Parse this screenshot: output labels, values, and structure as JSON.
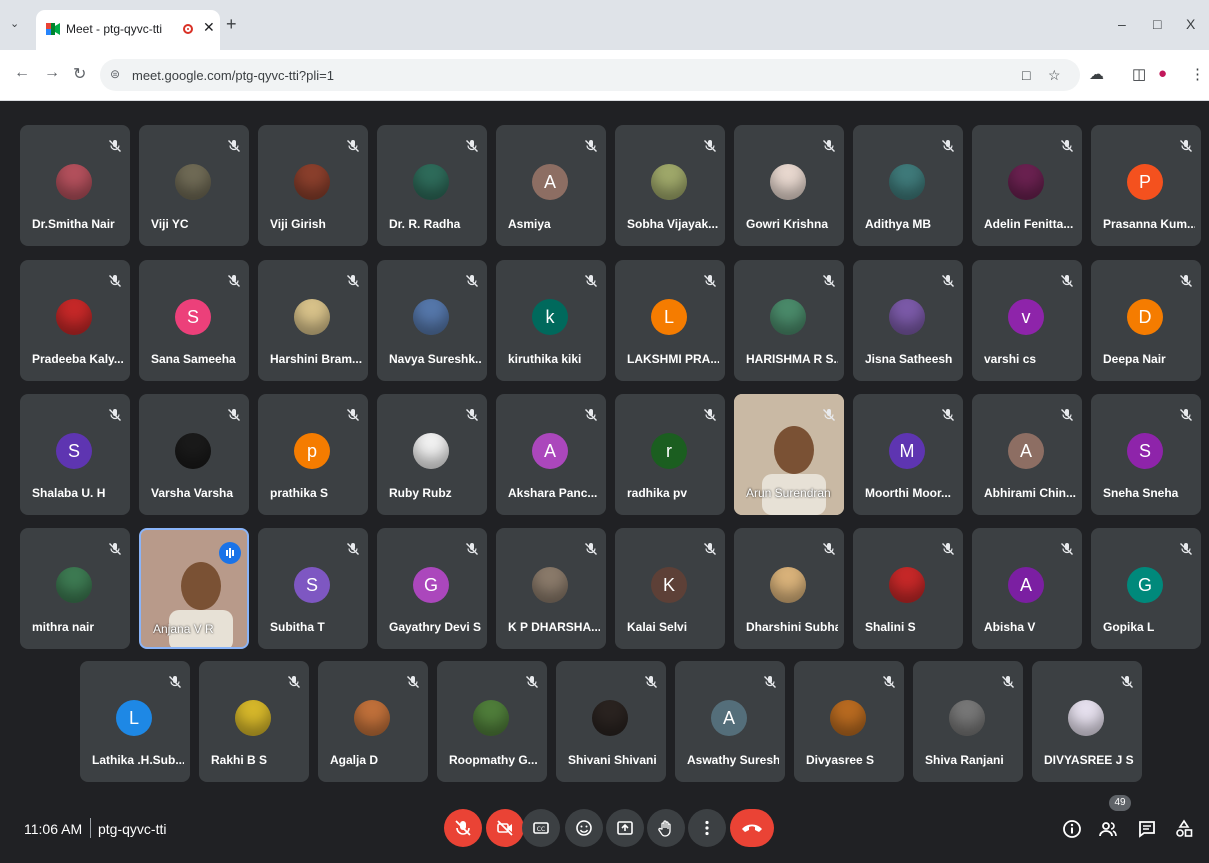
{
  "browser": {
    "tab_title": "Meet - ptg-qyvc-tti",
    "url": "meet.google.com/ptg-qyvc-tti?pli=1"
  },
  "colors": {
    "accent": "#1a73e8",
    "danger": "#ea4335",
    "tile": "#3c4043",
    "background": "#202124"
  },
  "participants": [
    {
      "name": "Dr.Smitha Nair",
      "avatar": "photo",
      "color": "#b3505c"
    },
    {
      "name": "Viji YC",
      "avatar": "photo",
      "color": "#6f6a55"
    },
    {
      "name": "Viji Girish",
      "avatar": "photo",
      "color": "#8a3f2c"
    },
    {
      "name": "Dr. R. Radha",
      "avatar": "photo",
      "color": "#2e6b5a"
    },
    {
      "name": "Asmiya",
      "avatar": "letter",
      "letter": "A",
      "color": "#8d6e63"
    },
    {
      "name": "Sobha Vijayak...",
      "avatar": "photo",
      "color": "#9fa86a"
    },
    {
      "name": "Gowri Krishna",
      "avatar": "photo",
      "color": "#e8d8cf"
    },
    {
      "name": "Adithya MB",
      "avatar": "photo",
      "color": "#3f7a7a"
    },
    {
      "name": "Adelin Fenitta...",
      "avatar": "photo",
      "color": "#6a2150"
    },
    {
      "name": "Prasanna Kum...",
      "avatar": "letter",
      "letter": "P",
      "color": "#f4511e"
    },
    {
      "name": "Pradeeba Kaly...",
      "avatar": "photo",
      "color": "#c62828"
    },
    {
      "name": "Sana Sameeha",
      "avatar": "letter",
      "letter": "S",
      "color": "#ec407a"
    },
    {
      "name": "Harshini Bram...",
      "avatar": "photo",
      "color": "#d8c28a"
    },
    {
      "name": "Navya Sureshk...",
      "avatar": "photo",
      "color": "#5577aa"
    },
    {
      "name": "kiruthika kiki",
      "avatar": "letter",
      "letter": "k",
      "color": "#00695c"
    },
    {
      "name": "LAKSHMI PRA...",
      "avatar": "letter",
      "letter": "L",
      "color": "#f57c00"
    },
    {
      "name": "HARISHMA R S...",
      "avatar": "photo",
      "color": "#4a8a6a"
    },
    {
      "name": "Jisna Satheesh",
      "avatar": "photo",
      "color": "#7b5aa8"
    },
    {
      "name": "varshi cs",
      "avatar": "letter",
      "letter": "v",
      "color": "#8e24aa"
    },
    {
      "name": "Deepa Nair",
      "avatar": "letter",
      "letter": "D",
      "color": "#f57c00"
    },
    {
      "name": "Shalaba U. H",
      "avatar": "letter",
      "letter": "S",
      "color": "#5e35b1"
    },
    {
      "name": "Varsha Varsha",
      "avatar": "photo",
      "color": "#1a1a1a"
    },
    {
      "name": "prathika S",
      "avatar": "letter",
      "letter": "p",
      "color": "#f57c00"
    },
    {
      "name": "Ruby Rubz",
      "avatar": "photo",
      "color": "#f1f1f1"
    },
    {
      "name": "Akshara Panc...",
      "avatar": "letter",
      "letter": "A",
      "color": "#ab47bc"
    },
    {
      "name": "radhika pv",
      "avatar": "letter",
      "letter": "r",
      "color": "#1b5e20"
    },
    {
      "name": "Arun Surendran",
      "avatar": "video",
      "color": "#c9b9a4"
    },
    {
      "name": "Moorthi Moor...",
      "avatar": "letter",
      "letter": "M",
      "color": "#5e35b1"
    },
    {
      "name": "Abhirami Chin...",
      "avatar": "letter",
      "letter": "A",
      "color": "#8d6e63"
    },
    {
      "name": "Sneha Sneha",
      "avatar": "letter",
      "letter": "S",
      "color": "#8e24aa"
    },
    {
      "name": "mithra nair",
      "avatar": "photo",
      "color": "#3d7a52"
    },
    {
      "name": "Anjana V R",
      "avatar": "video",
      "color": "#b89a8a"
    },
    {
      "name": "Subitha T",
      "avatar": "letter",
      "letter": "S",
      "color": "#7e57c2"
    },
    {
      "name": "Gayathry Devi S",
      "avatar": "letter",
      "letter": "G",
      "color": "#ab47bc"
    },
    {
      "name": "K P DHARSHA...",
      "avatar": "photo",
      "color": "#8a7a6a"
    },
    {
      "name": "Kalai Selvi",
      "avatar": "letter",
      "letter": "K",
      "color": "#5d4037"
    },
    {
      "name": "Dharshini Subha",
      "avatar": "photo",
      "color": "#d9b27a"
    },
    {
      "name": "Shalini S",
      "avatar": "photo",
      "color": "#c62828"
    },
    {
      "name": "Abisha V",
      "avatar": "letter",
      "letter": "A",
      "color": "#7b1fa2"
    },
    {
      "name": "Gopika L",
      "avatar": "letter",
      "letter": "G",
      "color": "#00897b"
    },
    {
      "name": "Lathika .H.Sub...",
      "avatar": "letter",
      "letter": "L",
      "color": "#1e88e5"
    },
    {
      "name": "Rakhi B S",
      "avatar": "photo",
      "color": "#d6b72a"
    },
    {
      "name": "Agalja D",
      "avatar": "photo",
      "color": "#c0703a"
    },
    {
      "name": "Roopmathy G...",
      "avatar": "photo",
      "color": "#4f7d3a"
    },
    {
      "name": "Shivani Shivani",
      "avatar": "photo",
      "color": "#2a2320"
    },
    {
      "name": "Aswathy Suresh",
      "avatar": "letter",
      "letter": "A",
      "color": "#546e7a"
    },
    {
      "name": "Divyasree S",
      "avatar": "photo",
      "color": "#b86a20"
    },
    {
      "name": "Shiva Ranjani",
      "avatar": "photo",
      "color": "#777777"
    },
    {
      "name": "DIVYASREE J S",
      "avatar": "photo",
      "color": "#e6e0ee"
    }
  ],
  "bottom_bar": {
    "time": "11:06 AM",
    "meeting_code": "ptg-qyvc-tti",
    "participant_count": "49"
  }
}
